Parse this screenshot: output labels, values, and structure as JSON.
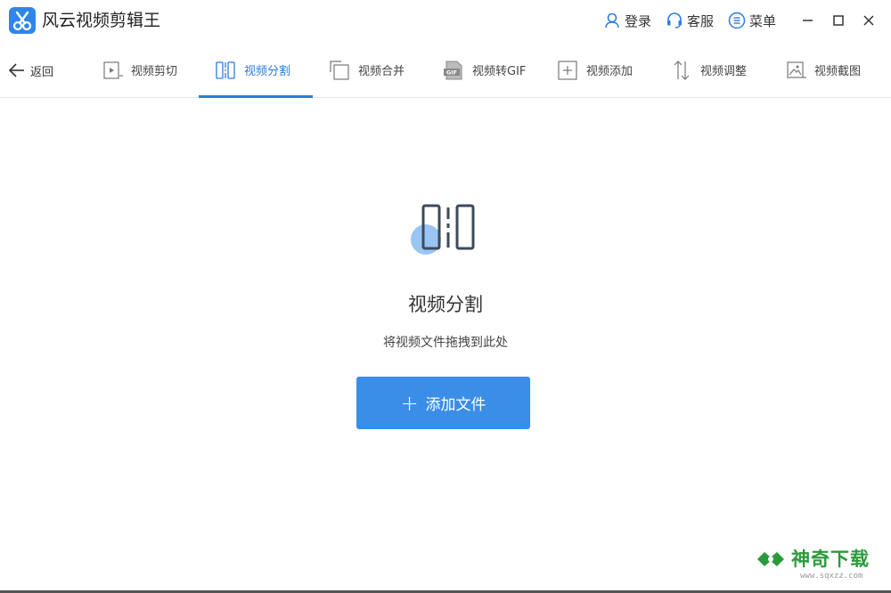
{
  "app": {
    "title": "风云视频剪辑王"
  },
  "header": {
    "login_label": "登录",
    "service_label": "客服",
    "menu_label": "菜单"
  },
  "toolbar": {
    "back_label": "返回",
    "tools": [
      {
        "label": "视频剪切",
        "icon": "play-frame-icon",
        "active": false
      },
      {
        "label": "视频分割",
        "icon": "split-icon",
        "active": true
      },
      {
        "label": "视频合并",
        "icon": "merge-icon",
        "active": false
      },
      {
        "label": "视频转GIF",
        "icon": "gif-icon",
        "active": false
      },
      {
        "label": "视频添加",
        "icon": "add-square-icon",
        "active": false
      },
      {
        "label": "视频调整",
        "icon": "adjust-arrows-icon",
        "active": false
      },
      {
        "label": "视频截图",
        "icon": "screenshot-icon",
        "active": false
      }
    ]
  },
  "main": {
    "title": "视频分割",
    "subtitle": "将视频文件拖拽到此处",
    "add_button_label": "添加文件"
  },
  "watermark": {
    "name": "神奇下载",
    "url": "www.sqxzz.com"
  },
  "colors": {
    "accent": "#2b7de0",
    "button": "#3a8ee8",
    "logo_bg": "#2f86e8",
    "watermark_green": "#2c9a3c"
  }
}
